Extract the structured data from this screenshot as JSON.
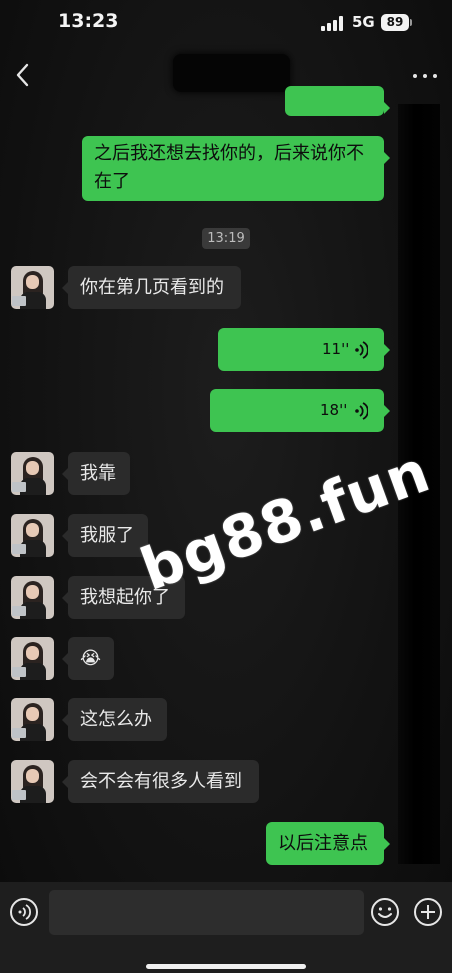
{
  "status_bar": {
    "time": "13:23",
    "network": "5G",
    "battery": "89"
  },
  "chat": {
    "timestamp": "13:19",
    "messages": [
      {
        "id": "m1",
        "text": "之后我还想去找你的，后来说你不在了"
      },
      {
        "id": "m2",
        "text": "你在第几页看到的"
      },
      {
        "id": "m3",
        "duration": "11''"
      },
      {
        "id": "m4",
        "duration": "18''"
      },
      {
        "id": "m5",
        "text": "我靠"
      },
      {
        "id": "m6",
        "text": "我服了"
      },
      {
        "id": "m7",
        "text": "我想起你了"
      },
      {
        "id": "m8",
        "text": "😭"
      },
      {
        "id": "m9",
        "text": "这怎么办"
      },
      {
        "id": "m10",
        "text": "会不会有很多人看到"
      },
      {
        "id": "m11",
        "text": "以后注意点"
      }
    ]
  },
  "watermark": "bg88.fun",
  "icons": {
    "back": "chevron-left-icon",
    "more": "more-dots-icon",
    "voice_play": "voice-wave-icon",
    "voice_input": "voice-input-icon",
    "emoji": "emoji-icon",
    "plus": "plus-icon"
  },
  "colors": {
    "outgoing_bubble": "#3ec451",
    "incoming_bubble": "#2b2b2b",
    "background": "#121212"
  }
}
